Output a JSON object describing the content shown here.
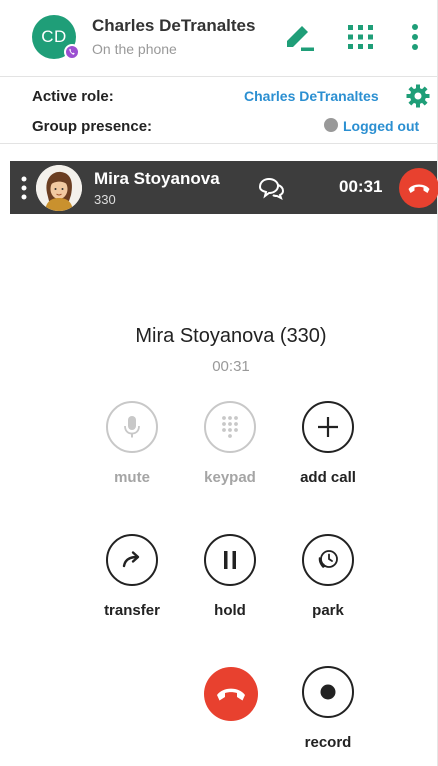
{
  "header": {
    "avatar_initials": "CD",
    "user_name": "Charles DeTranaltes",
    "user_status": "On the phone"
  },
  "roles": {
    "active_role_label": "Active role:",
    "active_role_value": "Charles DeTranaltes",
    "group_presence_label": "Group presence:",
    "group_presence_value": "Logged out"
  },
  "active_call": {
    "name": "Mira Stoyanova",
    "extension": "330",
    "duration": "00:31"
  },
  "call_panel": {
    "title": "Mira Stoyanova (330)",
    "timer": "00:31",
    "controls": {
      "mute": "mute",
      "keypad": "keypad",
      "add_call": "add call",
      "transfer": "transfer",
      "hold": "hold",
      "park": "park",
      "record": "record"
    }
  },
  "colors": {
    "brand_green": "#1f9e78",
    "accent_blue": "#2b8fd1",
    "hangup_red": "#e8412f",
    "call_bar": "#3d3d3d"
  }
}
